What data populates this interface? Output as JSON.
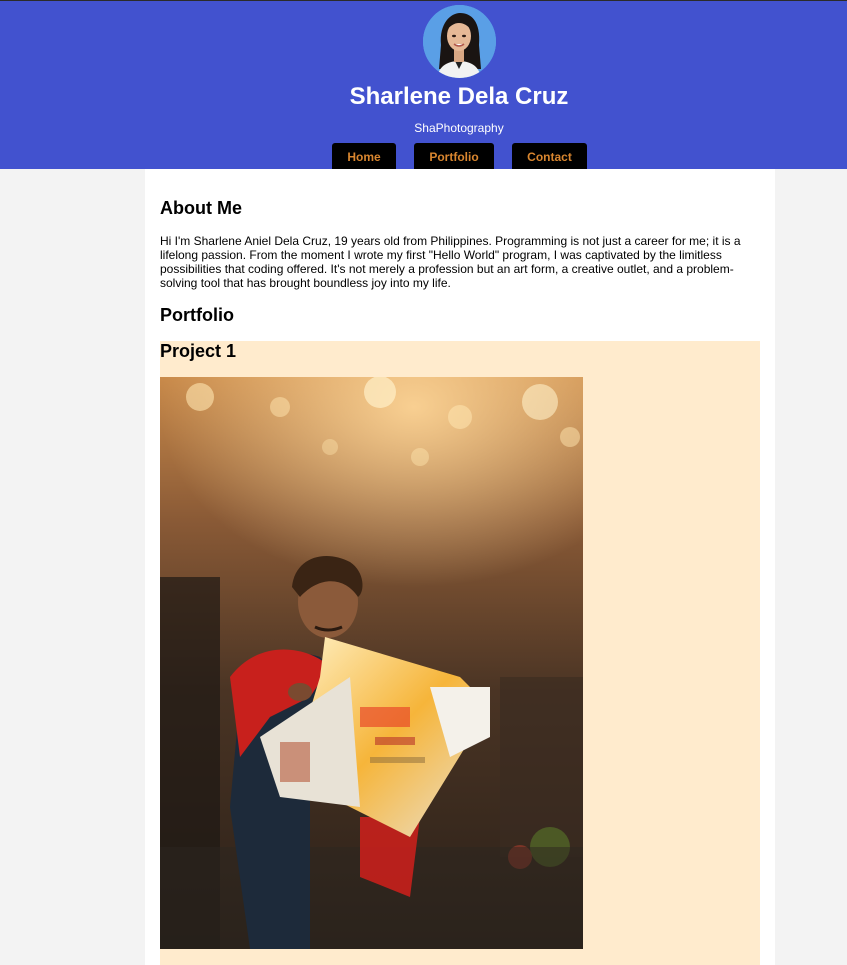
{
  "header": {
    "name": "Sharlene Dela Cruz",
    "tagline": "ShaPhotography"
  },
  "nav": {
    "items": [
      {
        "label": "Home"
      },
      {
        "label": "Portfolio"
      },
      {
        "label": "Contact"
      }
    ]
  },
  "about": {
    "heading": "About Me",
    "text": "Hi I'm Sharlene Aniel Dela Cruz, 19 years old from Philippines. Programming is not just a career for me; it is a lifelong passion. From the moment I wrote my first \"Hello World\" program, I was captivated by the limitless possibilities that coding offered. It's not merely a profession but an art form, a creative outlet, and a problem-solving tool that has brought boundless joy into my life."
  },
  "portfolio": {
    "heading": "Portfolio",
    "projects": [
      {
        "title": "Project 1"
      }
    ]
  },
  "colors": {
    "header_bg": "#4252cf",
    "nav_button_bg": "#000000",
    "nav_button_text": "#d9862f",
    "project_bg": "#ffebcd",
    "page_bg": "#f3f3f3"
  }
}
